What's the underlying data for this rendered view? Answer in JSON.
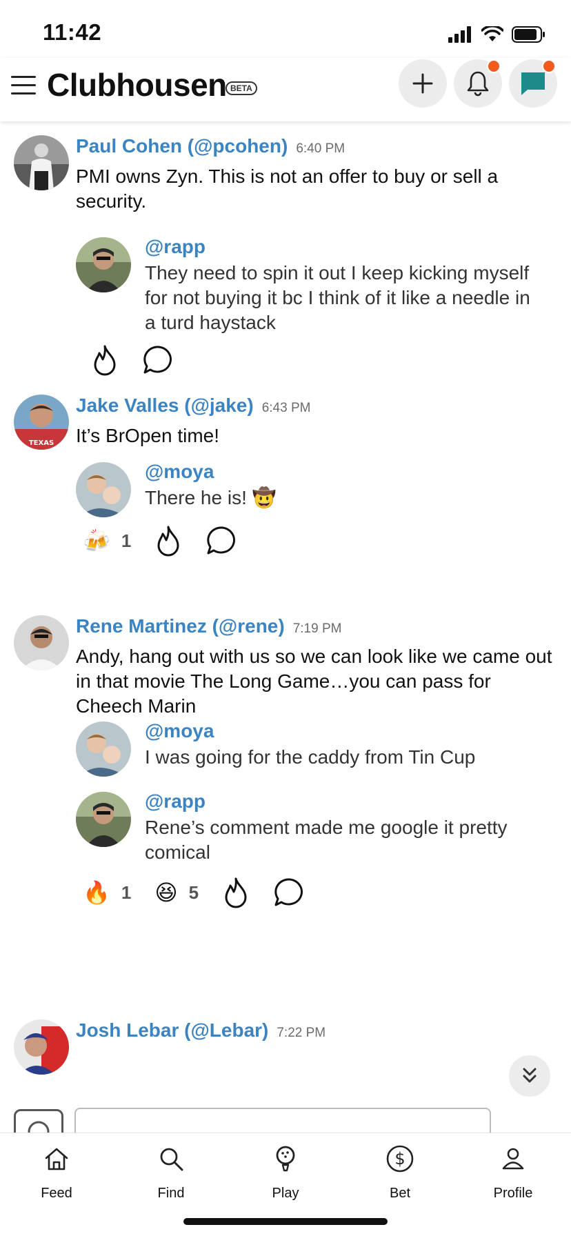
{
  "status_bar": {
    "time": "11:42"
  },
  "header": {
    "app_name": "Clubhousen",
    "beta_label": "BETA"
  },
  "posts": [
    {
      "author": "Paul Cohen (@pcohen)",
      "time": "6:40 PM",
      "text": "PMI owns Zyn.  This is not an offer to buy or sell a security.",
      "replies": [
        {
          "handle": "@rapp",
          "text": "They need to spin it out I keep kicking myself for not buying it bc I think of it like a needle in a turd haystack"
        }
      ],
      "reactions": []
    },
    {
      "author": "Jake Valles (@jake)",
      "time": "6:43 PM",
      "text": "It’s BrOpen time!",
      "replies": [
        {
          "handle": "@moya",
          "text": "There he is! 🤠"
        }
      ],
      "reactions": [
        {
          "emoji": "🍻",
          "count": "1"
        }
      ]
    },
    {
      "author": "Rene Martinez (@rene)",
      "time": "7:19 PM",
      "text": "Andy, hang out with us so we can look like we came out in that movie The Long Game…you can pass for Cheech Marin",
      "replies": [
        {
          "handle": "@moya",
          "text": "I was going for the caddy from Tin Cup"
        },
        {
          "handle": "@rapp",
          "text": "Rene’s comment made me google it pretty comical"
        }
      ],
      "reactions": [
        {
          "emoji": "🔥",
          "count": "1"
        },
        {
          "emoji": "😆",
          "count": "5"
        }
      ]
    },
    {
      "author": "Josh Lebar (@Lebar)",
      "time": "7:22 PM",
      "text": "",
      "replies": [],
      "reactions": []
    }
  ],
  "bottom_nav": {
    "items": [
      {
        "label": "Feed",
        "icon": "home-icon"
      },
      {
        "label": "Find",
        "icon": "search-icon"
      },
      {
        "label": "Play",
        "icon": "golf-ball-icon"
      },
      {
        "label": "Bet",
        "icon": "dollar-icon"
      },
      {
        "label": "Profile",
        "icon": "person-icon"
      }
    ]
  },
  "colors": {
    "link_blue": "#3b84c1",
    "notification_dot": "#f25a1e",
    "chat_teal": "#1e8a8a"
  }
}
